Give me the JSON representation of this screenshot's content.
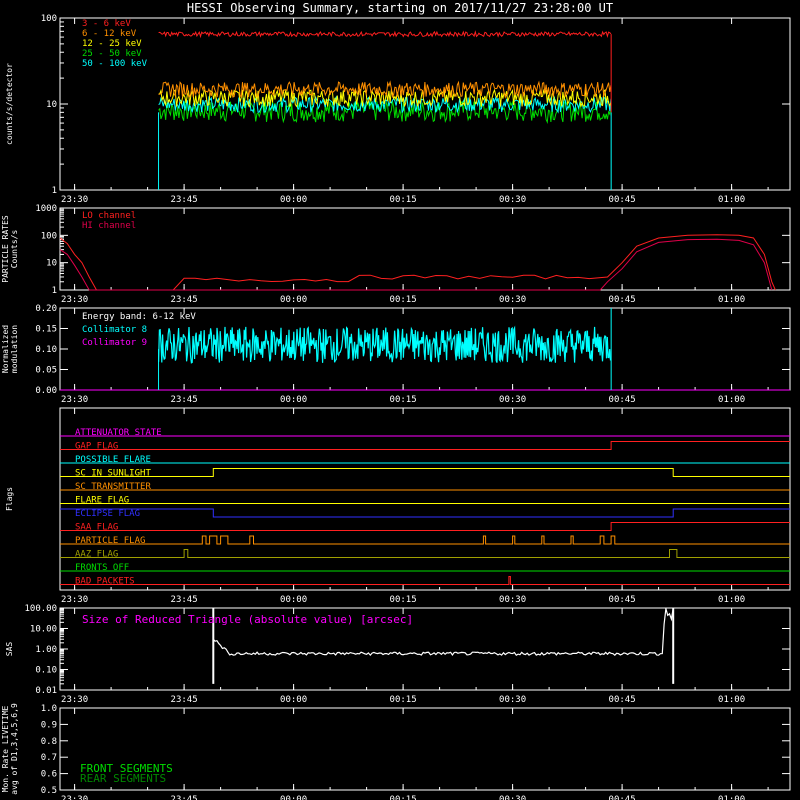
{
  "title": "HESSI Observing Summary, starting on 2017/11/27 23:28:00 UT",
  "time_labels": [
    "23:30",
    "23:45",
    "00:00",
    "00:15",
    "00:30",
    "00:45",
    "01:00"
  ],
  "colors": {
    "red": "#ff2020",
    "orange": "#ff9000",
    "yellow": "#ffff00",
    "green": "#00dd00",
    "cyan": "#00ffff",
    "magenta": "#ff00ff",
    "crimson": "#e0004a",
    "blue": "#3030ff",
    "olive": "#a0a000",
    "white": "#ffffff"
  },
  "chart_data": [
    {
      "type": "line",
      "ylabel": "counts/s/detector",
      "yscale": "log",
      "yticks": [
        "1",
        "10",
        "100"
      ],
      "xlim_minutes": [
        0,
        100
      ],
      "series": [
        {
          "name": "3 - 6 keV",
          "color": "#ff2020",
          "level": 65,
          "start_min": 13.5,
          "end_min": 75.5
        },
        {
          "name": "6 - 12 keV",
          "color": "#ff9000",
          "level": 15,
          "start_min": 13.5,
          "end_min": 75.5
        },
        {
          "name": "12 - 25 keV",
          "color": "#ffff00",
          "level": 12,
          "start_min": 13.5,
          "end_min": 75.5
        },
        {
          "name": "25 - 50 keV",
          "color": "#00dd00",
          "level": 8.5,
          "start_min": 13.5,
          "end_min": 75.5
        },
        {
          "name": "50 - 100 keV",
          "color": "#00ffff",
          "level": 10,
          "start_min": 13.5,
          "end_min": 75.5
        }
      ]
    },
    {
      "type": "line",
      "ylabel": "PARTICLE RATES Counts/s",
      "yscale": "log",
      "yticks": [
        "1",
        "10",
        "100",
        "1000"
      ],
      "series": [
        {
          "name": "LO channel",
          "color": "#ff2020"
        },
        {
          "name": "HI channel",
          "color": "#e0004a"
        }
      ]
    },
    {
      "type": "line",
      "ylabel": "Normalized modulation",
      "yticks": [
        "0.00",
        "0.05",
        "0.10",
        "0.15",
        "0.20"
      ],
      "ylim": [
        0,
        0.2
      ],
      "annotation": "Energy band: 6-12 keV",
      "series": [
        {
          "name": "Collimator 8",
          "color": "#00ffff",
          "level": 0.11,
          "start_min": 13.5,
          "end_min": 75.5
        },
        {
          "name": "Collimator 9",
          "color": "#ff00ff",
          "level": 0.0
        }
      ]
    },
    {
      "type": "line",
      "ylabel": "Flags",
      "flags": [
        {
          "name": "ATTENUATOR STATE",
          "color": "#ff00ff"
        },
        {
          "name": "GAP FLAG",
          "color": "#ff2020"
        },
        {
          "name": "POSSIBLE FLARE",
          "color": "#00ffff"
        },
        {
          "name": "SC IN SUNLIGHT",
          "color": "#ffff00"
        },
        {
          "name": "SC TRANSMITTER",
          "color": "#ff9000"
        },
        {
          "name": "FLARE FLAG",
          "color": "#ffff00"
        },
        {
          "name": "ECLIPSE FLAG",
          "color": "#3030ff"
        },
        {
          "name": "SAA FLAG",
          "color": "#ff2020"
        },
        {
          "name": "PARTICLE FLAG",
          "color": "#ff9000"
        },
        {
          "name": "AAZ FLAG",
          "color": "#a0a000"
        },
        {
          "name": "FRONTS OFF",
          "color": "#00dd00"
        },
        {
          "name": "BAD PACKETS",
          "color": "#ff2020"
        }
      ]
    },
    {
      "type": "line",
      "ylabel": "SAS",
      "yscale": "log",
      "yticks": [
        "0.01",
        "0.10",
        "1.00",
        "10.00",
        "100.00"
      ],
      "annotation": "Size of Reduced Triangle (absolute value) [arcsec]",
      "series": [
        {
          "color": "#ffffff",
          "level": 0.6,
          "start_min": 21,
          "end_min": 84
        }
      ]
    },
    {
      "type": "line",
      "ylabel": "Mon. Rate LIVETIME avg of D1,3,4,5,6,9",
      "yticks": [
        "0.5",
        "0.6",
        "0.7",
        "0.8",
        "0.9",
        "1.0"
      ],
      "ylim": [
        0.5,
        1.0
      ],
      "labels": [
        {
          "text": "FRONT SEGMENTS",
          "color": "#00dd00"
        },
        {
          "text": "REAR SEGMENTS",
          "color": "#008800"
        }
      ]
    }
  ]
}
